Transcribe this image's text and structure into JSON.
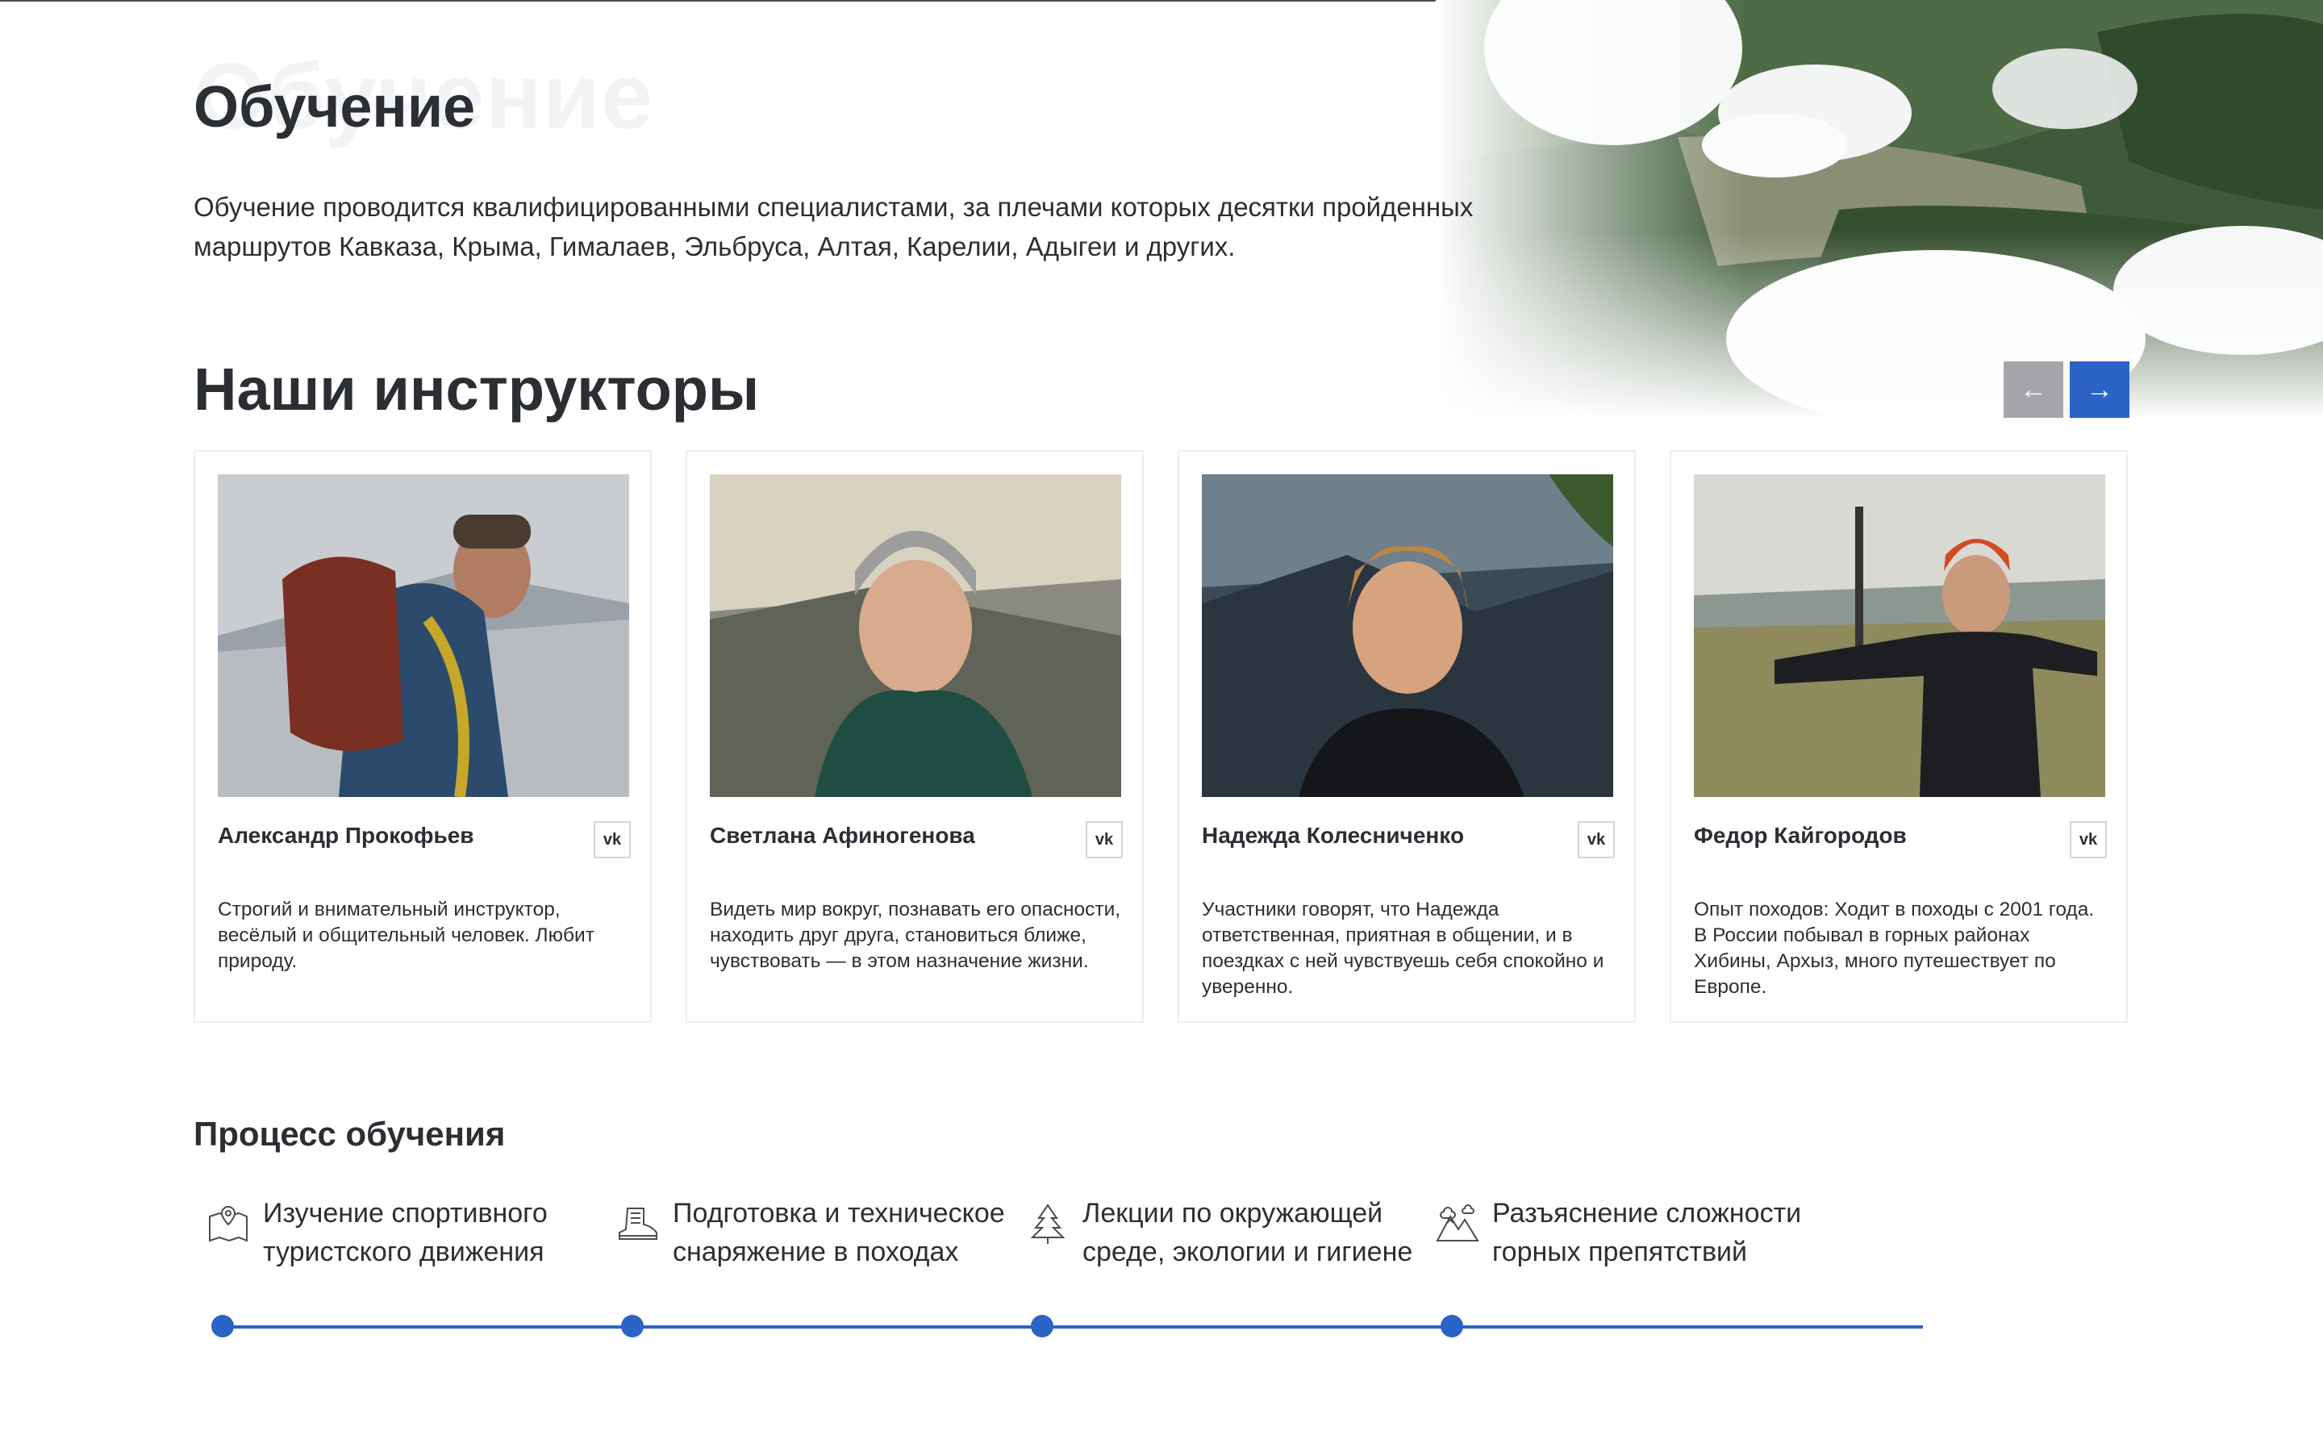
{
  "header": {
    "ghost_title": "Обучение",
    "title": "Обучение",
    "intro": "Обучение проводится квалифицированными специалистами, за плечами которых десятки пройденных маршрутов Кавказа, Крыма, Гималаев, Эльбруса, Алтая, Карелии, Адыгеи и других."
  },
  "instructors": {
    "title": "Наши инструкторы",
    "prev_label": "←",
    "next_label": "→",
    "vk_label": "vk",
    "cards": [
      {
        "name": "Александр Прокофьев",
        "description": "Строгий и внимательный инструктор, весёлый и общительный человек. Любит природу."
      },
      {
        "name": "Светлана Афиногенова",
        "description": "Видеть мир вокруг, познавать его опасности, находить друг друга, становиться ближе, чувствовать — в этом назначение жизни."
      },
      {
        "name": "Надежда Колесниченко",
        "description": "Участники говорят, что Надежда ответственная, приятная в общении, и в поездках с ней чувствуешь себя спокойно и уверенно."
      },
      {
        "name": "Федор Кайгородов",
        "description": "Опыт походов: Ходит в походы с 2001 года. В России побывал в горных районах Хибины, Архыз, много путешествует по Европе."
      }
    ]
  },
  "process": {
    "title": "Процесс обучения",
    "steps": [
      {
        "icon": "map-pin-icon",
        "label": "Изучение спортивного туристского движения"
      },
      {
        "icon": "hiking-boot-icon",
        "label": "Подготовка и техническое снаряжение в походах"
      },
      {
        "icon": "pine-tree-icon",
        "label": "Лекции по окружающей среде, экологии и гигиене"
      },
      {
        "icon": "mountains-icon",
        "label": "Разъяснение сложности горных препятствий"
      }
    ]
  },
  "colors": {
    "accent": "#2b63c6",
    "text": "#2b2f33",
    "nav_inactive": "#a4a6a9"
  }
}
